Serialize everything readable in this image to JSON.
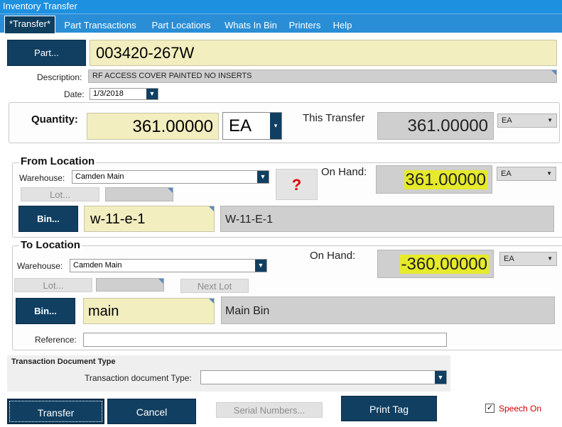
{
  "window": {
    "title": "Inventory Transfer"
  },
  "tabs": [
    {
      "label": "*Transfer*"
    },
    {
      "label": "Part Transactions"
    },
    {
      "label": "Part Locations"
    },
    {
      "label": "Whats In Bin"
    },
    {
      "label": "Printers"
    },
    {
      "label": "Help"
    }
  ],
  "part": {
    "button_label": "Part...",
    "value": "003420-267W",
    "description_label": "Description:",
    "description": "RF ACCESS COVER PAINTED NO INSERTS",
    "date_label": "Date:",
    "date": "1/3/2018"
  },
  "quantity": {
    "label": "Quantity:",
    "value": "361.00000",
    "uom": "EA",
    "this_transfer_label": "This Transfer",
    "this_transfer_value": "361.00000",
    "this_transfer_uom": "EA"
  },
  "from": {
    "title": "From Location",
    "warehouse_label": "Warehouse:",
    "warehouse": "Camden Main",
    "help_glyph": "?",
    "on_hand_label": "On Hand:",
    "on_hand": "361.00000",
    "on_hand_uom": "EA",
    "lot_label": "Lot...",
    "bin_button": "Bin...",
    "bin_value": "w-11-e-1",
    "bin_description": "W-11-E-1"
  },
  "to": {
    "title": "To Location",
    "warehouse_label": "Warehouse:",
    "warehouse": "Camden Main",
    "on_hand_label": "On Hand:",
    "on_hand": "-360.00000",
    "on_hand_uom": "EA",
    "lot_label": "Lot...",
    "next_lot_label": "Next Lot",
    "bin_button": "Bin...",
    "bin_value": "main",
    "bin_description": "Main Bin",
    "reference_label": "Reference:",
    "reference": ""
  },
  "transaction_doc": {
    "section_title": "Transaction Document Type",
    "label": "Transaction document Type:",
    "value": ""
  },
  "actions": {
    "transfer": "Transfer",
    "cancel": "Cancel",
    "serial_numbers": "Serial Numbers...",
    "print_tag": "Print Tag",
    "speech_on": "Speech On"
  },
  "colors": {
    "tab_bar": "#2a8ed6",
    "navy": "#103f61",
    "yellow_field": "#f2eebf",
    "highlight": "#e6ea2a",
    "speech_red": "#cc0000"
  }
}
